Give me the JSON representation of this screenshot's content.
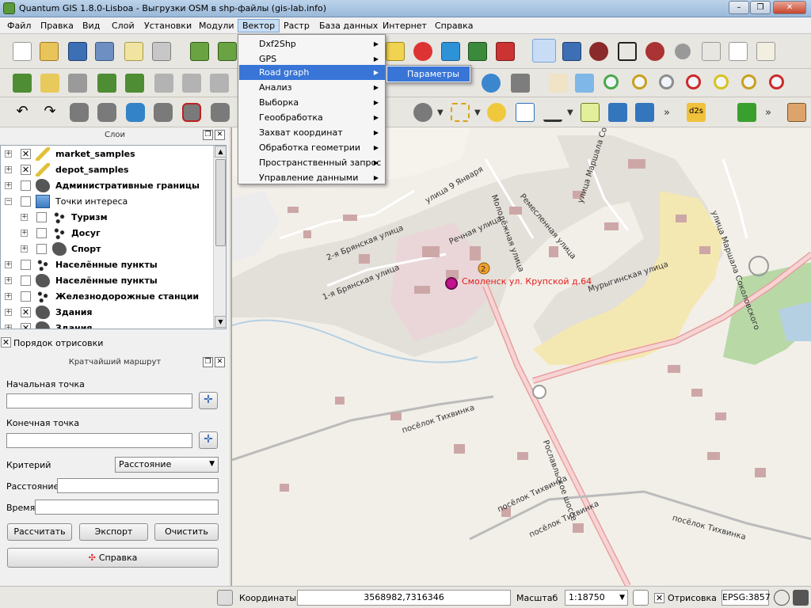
{
  "window": {
    "title": "Quantum GIS 1.8.0-Lisboa - Выгрузки OSM в shp-файлы (gis-lab.info)"
  },
  "menubar": [
    "Файл",
    "Правка",
    "Вид",
    "Слой",
    "Установки",
    "Модули",
    "Вектор",
    "Растр",
    "База данных",
    "Интернет",
    "Справка"
  ],
  "vector_menu": {
    "items": [
      "Dxf2Shp",
      "GPS",
      "Road graph",
      "Анализ",
      "Выборка",
      "Геообработка",
      "Захват координат",
      "Обработка геометрии",
      "Пространственный запрос",
      "Управление данными"
    ],
    "highlighted": "Road graph",
    "submenu": [
      "Параметры"
    ]
  },
  "layers_panel": {
    "title": "Слои",
    "layers": [
      {
        "name": "market_samples",
        "checked": true,
        "bold": true,
        "icon": "pencil-icon"
      },
      {
        "name": "depot_samples",
        "checked": true,
        "bold": true,
        "icon": "pencil-icon"
      },
      {
        "name": "Административные границы",
        "checked": false,
        "bold": true,
        "icon": "polygon-icon"
      },
      {
        "name": "Точки интереса",
        "checked": false,
        "bold": false,
        "icon": "group-icon"
      },
      {
        "name": "Туризм",
        "checked": false,
        "bold": true,
        "icon": "points-icon"
      },
      {
        "name": "Досуг",
        "checked": false,
        "bold": true,
        "icon": "points-icon"
      },
      {
        "name": "Спорт",
        "checked": false,
        "bold": true,
        "icon": "polygon-icon"
      },
      {
        "name": "Населённые пункты",
        "checked": false,
        "bold": true,
        "icon": "points-icon"
      },
      {
        "name": "Населённые пункты",
        "checked": false,
        "bold": true,
        "icon": "polygon-icon"
      },
      {
        "name": "Железнодорожные станции",
        "checked": false,
        "bold": true,
        "icon": "points-icon"
      },
      {
        "name": "Здания",
        "checked": true,
        "bold": true,
        "icon": "polygon-icon"
      },
      {
        "name": "Здания",
        "checked": true,
        "bold": true,
        "icon": "polygon-icon"
      }
    ],
    "render_order_label": "Порядок отрисовки"
  },
  "route_panel": {
    "title": "Кратчайший маршрут",
    "start_label": "Начальная точка",
    "end_label": "Конечная точка",
    "criterion_label": "Критерий",
    "criterion_value": "Расстояние",
    "distance_label": "Расстояние",
    "time_label": "Время",
    "calc_button": "Рассчитать",
    "export_button": "Экспорт",
    "clear_button": "Очистить",
    "help_button": "Справка"
  },
  "map": {
    "labels": [
      "улица 9 Января",
      "2-я Брянская улица",
      "1-я Брянская улица",
      "Речная улица",
      "Молодёжная улица",
      "Ремесленная улица",
      "улица Маршала Соколовского",
      "улица Маршала Соколовского",
      "Мурыгинская улица",
      "Смоленск ул. Крупской д.64",
      "посёлок Тихвинка",
      "посёлок Тихвинка",
      "посёлок Тихвинка",
      "посёлок Тихвинка",
      "Рославльское шоссе"
    ],
    "marker_number": "2"
  },
  "statusbar": {
    "coords_label": "Координаты:",
    "coords_value": "3568982,7316346",
    "scale_label": "Масштаб",
    "scale_value": "1:18750",
    "render_label": "Отрисовка",
    "epsg": "EPSG:3857"
  }
}
